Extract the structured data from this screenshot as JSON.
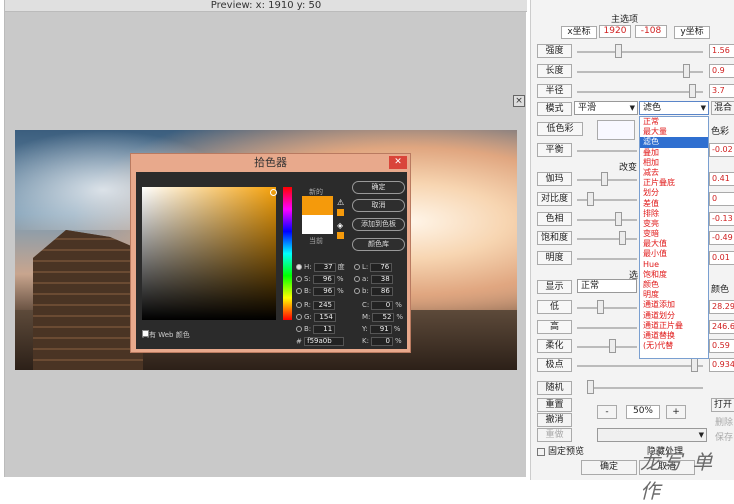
{
  "preview": {
    "title": "Preview:  x: 1910 y: 50",
    "close_glyph": "×"
  },
  "picker": {
    "title": "拾色器",
    "close_glyph": "✕",
    "new_label": "新的",
    "current_label": "当前",
    "web_only_label": "只有 Web 颜色",
    "buttons": [
      "确定",
      "取消",
      "添加到色板",
      "颜色库"
    ],
    "fields_left": [
      {
        "name": "H:",
        "value": "37",
        "unit": "度",
        "on": true
      },
      {
        "name": "S:",
        "value": "96",
        "unit": "%",
        "on": false
      },
      {
        "name": "B:",
        "value": "96",
        "unit": "%",
        "on": false
      },
      {
        "name": "R:",
        "value": "245",
        "unit": "",
        "on": false
      },
      {
        "name": "G:",
        "value": "154",
        "unit": "",
        "on": false
      },
      {
        "name": "B:",
        "value": "11",
        "unit": "",
        "on": false
      }
    ],
    "fields_right": [
      {
        "name": "L:",
        "value": "76",
        "unit": ""
      },
      {
        "name": "a:",
        "value": "38",
        "unit": ""
      },
      {
        "name": "b:",
        "value": "86",
        "unit": ""
      },
      {
        "name": "C:",
        "value": "0",
        "unit": "%"
      },
      {
        "name": "M:",
        "value": "52",
        "unit": "%"
      },
      {
        "name": "Y:",
        "value": "91",
        "unit": "%"
      },
      {
        "name": "K:",
        "value": "0",
        "unit": "%"
      }
    ],
    "hex_label": "#",
    "hex_value": "f59a0b",
    "colors": {
      "new": "#f59a0b",
      "current": "#ffffff"
    }
  },
  "panel": {
    "group_title": "主选项",
    "x_label": "x坐标",
    "x_value": "1920",
    "y_value": "-108",
    "y_label": "y坐标",
    "rows": [
      {
        "label": "强度",
        "value": "1.56"
      },
      {
        "label": "长度",
        "value": "0.9"
      },
      {
        "label": "半径",
        "value": "3.7"
      }
    ],
    "mode_label": "模式",
    "mode_value": "平滑",
    "blend_value": "滤色",
    "blend_partial": "混合",
    "lowcolor_label": "低色彩",
    "color_partial": "色彩",
    "balance_label": "平衡",
    "balance_value": "-0.02",
    "change_label": "改变",
    "adjust_rows": [
      {
        "label": "伽玛",
        "value": "0.41"
      },
      {
        "label": "对比度",
        "value": "0"
      },
      {
        "label": "色相",
        "value": "-0.13"
      },
      {
        "label": "饱和度",
        "value": "-0.49"
      },
      {
        "label": "明度",
        "value": "0.01"
      }
    ],
    "selection_label": "选",
    "display_label": "显示",
    "display_value": "正常",
    "display_partial": "颜色",
    "low_label": "低",
    "low_value": "28.29",
    "high_label": "高",
    "high_value": "246.6",
    "soft_label": "柔化",
    "soft_value": "0.59",
    "pole_label": "极点",
    "pole_value": "0.934",
    "random_label": "随机",
    "reset_label": "重置",
    "undo_label": "撤消",
    "redo_label": "重做",
    "zoom_minus": "-",
    "zoom_value": "50%",
    "zoom_plus": "+",
    "open_label": "打开",
    "delete_label": "删除",
    "save_label": "保存",
    "fixed_preview_label": "固定预览",
    "hide_label": "隐藏处理",
    "ok_label": "确定",
    "cancel_label": "取消",
    "dropdown_items": [
      "正常",
      "最大量",
      "滤色",
      "叠加",
      "相加",
      "减去",
      "正片叠底",
      "划分",
      "差值",
      "排除",
      "变亮",
      "变暗",
      "最大值",
      "最小值",
      "Hue",
      "饱和度",
      "颜色",
      "明度",
      "通道添加",
      "通道划分",
      "通道正片叠",
      "通道替换",
      "(无)代替"
    ],
    "dropdown_selected": 2
  },
  "watermark": "龙写 单 作"
}
